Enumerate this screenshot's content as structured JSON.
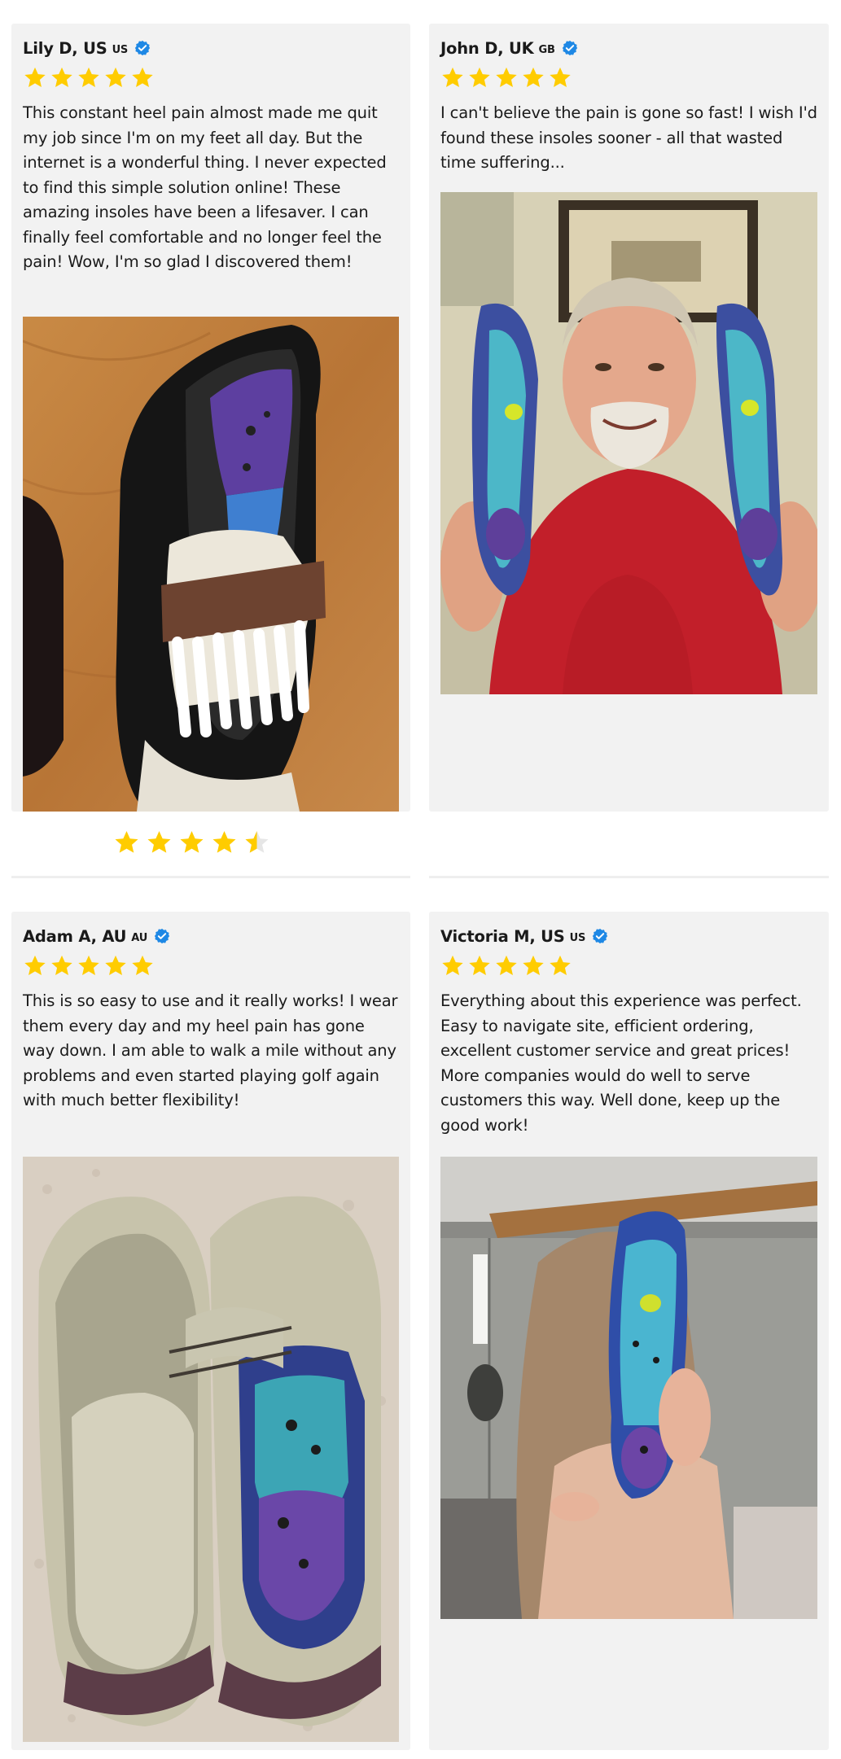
{
  "colors": {
    "card_bg": "#f2f2f2",
    "star": "#ffcc00",
    "verified": "#1e88e5"
  },
  "reviews": [
    {
      "name": "Lily D, US",
      "country": "US",
      "rating": 5,
      "text": "This constant heel pain almost made me quit my job since I'm on my feet all day. But the internet is a wonderful thing. I never expected to find this simple solution online! These amazing insoles have been a lifesaver. I can finally feel comfortable and no longer feel the pain! Wow, I'm so glad I discovered them!"
    },
    {
      "name": "John D, UK",
      "country": "GB",
      "rating": 5,
      "text": "I can't believe the pain is gone so fast! I wish I'd found these insoles sooner - all that wasted time suffering..."
    },
    {
      "name": "Adam A, AU",
      "country": "AU",
      "rating": 5,
      "text": "This is so easy to use and it really works! I wear them every day and my heel pain has gone way down. I am able to walk a mile without any problems and even started playing golf again with much better flexibility!"
    },
    {
      "name": "Victoria M, US",
      "country": "US",
      "rating": 5,
      "text": "Everything about this experience was perfect. Easy to navigate site, efficient ordering, excellent customer service and great prices! More companies would do well to serve customers this way. Well done, keep up the good work!"
    }
  ],
  "average_rating": 4.5,
  "icons": {
    "star": "star-icon",
    "verified": "verified-badge-icon"
  }
}
